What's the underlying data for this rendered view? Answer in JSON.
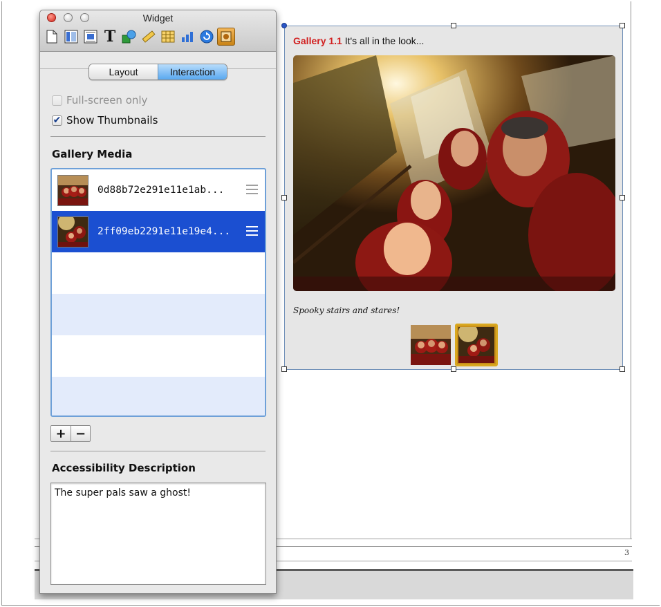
{
  "window": {
    "title": "Widget"
  },
  "toolbar": {
    "icons": [
      "document-icon",
      "layout-icon",
      "wrap-icon",
      "text-icon",
      "graphic-icon",
      "metrics-icon",
      "table-icon",
      "chart-icon",
      "link-icon",
      "widget-icon"
    ],
    "active": "widget-icon"
  },
  "tabs": {
    "layout": "Layout",
    "interaction": "Interaction",
    "selected": "Interaction"
  },
  "options": {
    "fullscreen_label": "Full-screen only",
    "fullscreen_checked": false,
    "thumbnails_label": "Show Thumbnails",
    "thumbnails_checked": true
  },
  "gallery_media": {
    "heading": "Gallery Media",
    "items": [
      {
        "name": "0d88b72e291e11e1ab..."
      },
      {
        "name": "2ff09eb2291e11e19e4...",
        "selected": true
      }
    ]
  },
  "buttons": {
    "add": "+",
    "remove": "−"
  },
  "accessibility": {
    "heading": "Accessibility Description",
    "text": "The super pals saw a ghost!"
  },
  "widget": {
    "label": "Gallery 1.1",
    "title": " It's all in the look...",
    "caption": "Spooky stairs and stares!",
    "thumbnail_count": 2,
    "selected_thumbnail": 2
  },
  "page": {
    "number": "3"
  },
  "colors": {
    "label_red": "#d11f1f",
    "selection_blue": "#1b4fd1",
    "active_tool_orange": "#e5a235"
  }
}
